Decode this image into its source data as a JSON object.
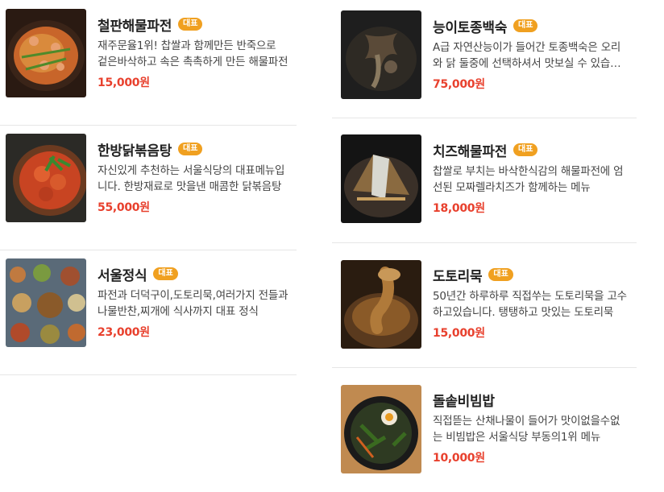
{
  "menu_left": [
    {
      "name": "철판해물파전",
      "badge": "대표",
      "desc": "재주문율1위! 찹쌀과 함께만든 반죽으로 겉은바삭하고 속은 촉촉하게 만든 해물파전",
      "price": "15,000원"
    },
    {
      "name": "한방닭볶음탕",
      "badge": "대표",
      "desc": "자신있게 추천하는 서울식당의 대표메뉴입니다. 한방재료로 맛을낸 매콤한 닭볶음탕",
      "price": "55,000원"
    },
    {
      "name": "서울정식",
      "badge": "대표",
      "desc": "파전과 더덕구이,도토리묵,여러가지 전들과 나물반찬,찌개에 식사까지 대표 정식",
      "price": "23,000원"
    }
  ],
  "menu_right": [
    {
      "name": "능이토종백숙",
      "badge": "대표",
      "desc": "A급 자연산능이가 들어간 토종백숙은 오리와 닭 둘중에 선택하셔서 맛보실 수 있습니다",
      "price": "75,000원"
    },
    {
      "name": "치즈해물파전",
      "badge": "대표",
      "desc": "찹쌀로 부치는 바삭한식감의 해물파전에 엄선된 모짜렐라치즈가 함께하는 메뉴",
      "price": "18,000원"
    },
    {
      "name": "도토리묵",
      "badge": "대표",
      "desc": "50년간 하루하루 직접쑤는 도토리묵을 고수하고있습니다. 탱탱하고 맛있는 도토리묵",
      "price": "15,000원"
    },
    {
      "name": "돌솥비빔밥",
      "badge": "",
      "desc": "직접뜯는 산채나물이 들어가 맛이없을수없는 비빔밥은 서울식당 부동의1위 메뉴",
      "price": "10,000원"
    }
  ],
  "images": [
    "seafood-pancake-photo",
    "braised-chicken-photo",
    "korean-set-meal-photo",
    "chicken-soup-photo",
    "cheese-pancake-photo",
    "acorn-jelly-photo",
    "bibimbap-photo"
  ]
}
